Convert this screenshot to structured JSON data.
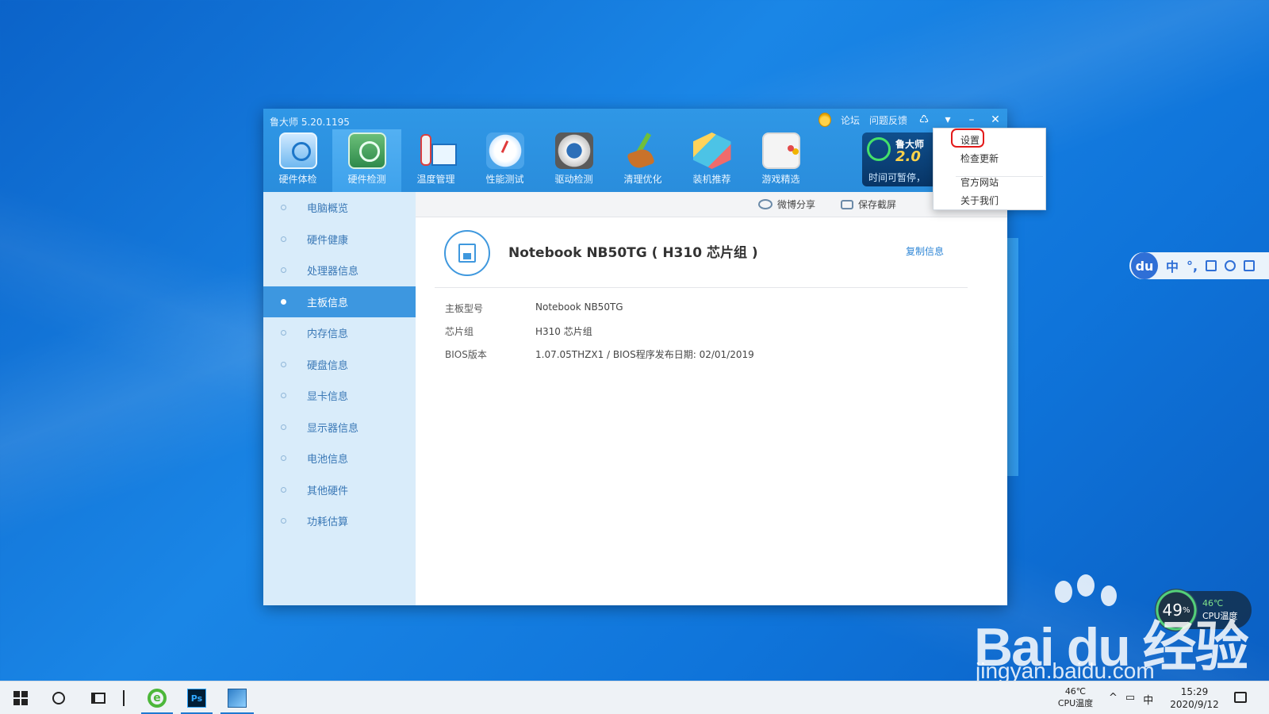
{
  "app": {
    "title": "鲁大师 5.20.1195",
    "title_links": [
      "论坛",
      "问题反馈"
    ],
    "toolbar": [
      {
        "label": "硬件体检",
        "icon": "monitor-check-icon"
      },
      {
        "label": "硬件检测",
        "icon": "motherboard-icon",
        "active": true
      },
      {
        "label": "温度管理",
        "icon": "thermometer-icon"
      },
      {
        "label": "性能测试",
        "icon": "speed-gauge-icon"
      },
      {
        "label": "驱动检测",
        "icon": "gear-icon"
      },
      {
        "label": "清理优化",
        "icon": "broom-icon"
      },
      {
        "label": "装机推荐",
        "icon": "cube-icon"
      },
      {
        "label": "游戏精选",
        "icon": "gamepad-icon"
      }
    ],
    "promo": {
      "line1": "鲁大师",
      "line2": "2.0",
      "line3": "时间可暂停，"
    }
  },
  "menu": {
    "items": [
      "设置",
      "检查更新",
      "官方网站",
      "关于我们"
    ]
  },
  "sidebar": {
    "items": [
      {
        "label": "电脑概览"
      },
      {
        "label": "硬件健康"
      },
      {
        "label": "处理器信息"
      },
      {
        "label": "主板信息",
        "active": true
      },
      {
        "label": "内存信息"
      },
      {
        "label": "硬盘信息"
      },
      {
        "label": "显卡信息"
      },
      {
        "label": "显示器信息"
      },
      {
        "label": "电池信息"
      },
      {
        "label": "其他硬件"
      },
      {
        "label": "功耗估算"
      }
    ]
  },
  "actions": {
    "share": "微博分享",
    "screenshot": "保存截屏"
  },
  "board": {
    "title": "Notebook NB50TG ( H310 芯片组 )",
    "copy_label": "复制信息",
    "rows": [
      {
        "key": "主板型号",
        "value": "Notebook NB50TG"
      },
      {
        "key": "芯片组",
        "value": "H310 芯片组"
      },
      {
        "key": "BIOS版本",
        "value": "1.07.05THZX1  /  BIOS程序发布日期: 02/01/2019"
      }
    ]
  },
  "ime": {
    "logo": "du",
    "mode": "中"
  },
  "cpu_widget": {
    "percent": "49",
    "percent_unit": "%",
    "temp": "46℃",
    "label": "CPU温度"
  },
  "watermark": {
    "big": "Bai du 经验",
    "url": "jingyan.baidu.com"
  },
  "taskbar": {
    "tray_temp": "46℃",
    "tray_temp_label": "CPU温度",
    "time": "15:29",
    "date": "2020/9/12",
    "ps_label": "Ps"
  }
}
